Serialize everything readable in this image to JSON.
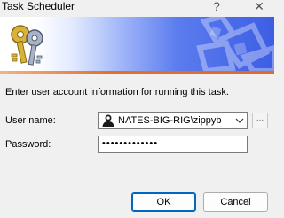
{
  "window": {
    "title": "Task Scheduler",
    "help_glyph": "?",
    "close_glyph": "✕"
  },
  "instruction": "Enter user account information for running this task.",
  "form": {
    "username_label": "User name:",
    "username_value": "NATES-BIG-RIG\\zippyb",
    "browse_label": "...",
    "password_label": "Password:",
    "password_mask": "•••••••••••••"
  },
  "buttons": {
    "ok": "OK",
    "cancel": "Cancel"
  },
  "colors": {
    "accent": "#0067c0",
    "banner_blue": "#3d5ee4",
    "banner_stripe": "#e06a28"
  },
  "icons": [
    "keys-icon",
    "banner-graphic",
    "user-icon",
    "chevron-down-icon"
  ]
}
